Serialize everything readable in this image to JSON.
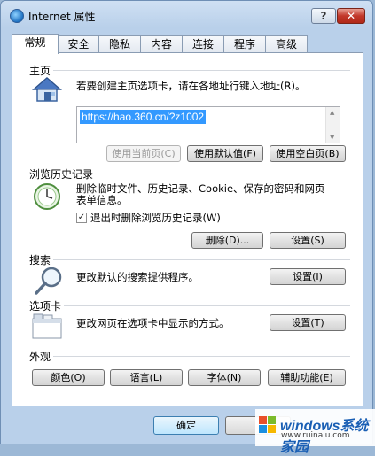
{
  "window": {
    "title": "Internet 属性",
    "help_label": "?",
    "close_label": "✕"
  },
  "tabs": [
    {
      "label": "常规"
    },
    {
      "label": "安全"
    },
    {
      "label": "隐私"
    },
    {
      "label": "内容"
    },
    {
      "label": "连接"
    },
    {
      "label": "程序"
    },
    {
      "label": "高级"
    }
  ],
  "homepage": {
    "title": "主页",
    "desc": "若要创建主页选项卡，请在各地址行键入地址(R)。",
    "url": "https://hao.360.cn/?z1002",
    "use_current": "使用当前页(C)",
    "use_default": "使用默认值(F)",
    "use_blank": "使用空白页(B)"
  },
  "history": {
    "title": "浏览历史记录",
    "desc_line1": "删除临时文件、历史记录、Cookie、保存的密码和网页",
    "desc_line2": "表单信息。",
    "checkbox_label": "退出时删除浏览历史记录(W)",
    "checkbox_checked": true,
    "check_mark": "✓",
    "delete_label": "删除(D)...",
    "settings_label": "设置(S)"
  },
  "search": {
    "title": "搜索",
    "desc": "更改默认的搜索提供程序。",
    "settings_label": "设置(I)"
  },
  "tabsec": {
    "title": "选项卡",
    "desc": "更改网页在选项卡中显示的方式。",
    "settings_label": "设置(T)"
  },
  "appearance": {
    "title": "外观",
    "colors": "颜色(O)",
    "languages": "语言(L)",
    "fonts": "字体(N)",
    "accessibility": "辅助功能(E)"
  },
  "footer": {
    "ok_label": "确定"
  },
  "watermark": {
    "text": "windows系统家园",
    "sub": "www.ruinaiu.com"
  }
}
